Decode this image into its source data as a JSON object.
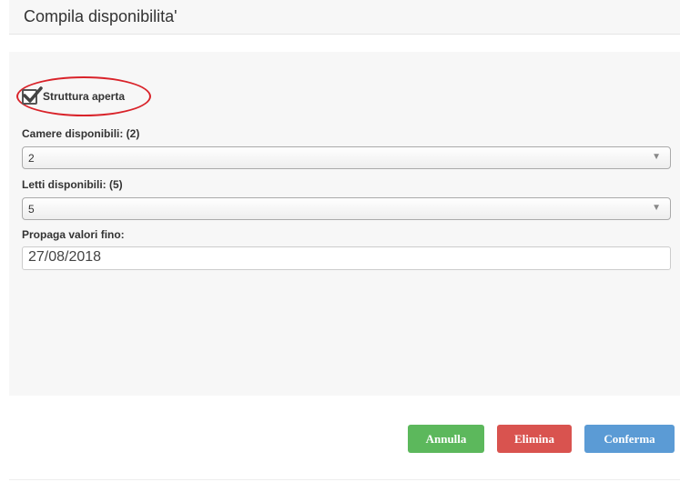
{
  "header": {
    "title": "Compila disponibilita'"
  },
  "form": {
    "checkbox": {
      "label": "Struttura aperta",
      "checked": true
    },
    "camere": {
      "label": "Camere disponibili: (2)",
      "value": "2"
    },
    "letti": {
      "label": "Letti disponibili: (5)",
      "value": "5"
    },
    "propaga": {
      "label": "Propaga valori fino:",
      "value": "27/08/2018"
    }
  },
  "buttons": {
    "annulla": "Annulla",
    "elimina": "Elimina",
    "conferma": "Conferma"
  },
  "colors": {
    "annulla": "#5cb85c",
    "elimina": "#d9534f",
    "conferma": "#5b9bd5",
    "highlight": "#d9232a"
  }
}
